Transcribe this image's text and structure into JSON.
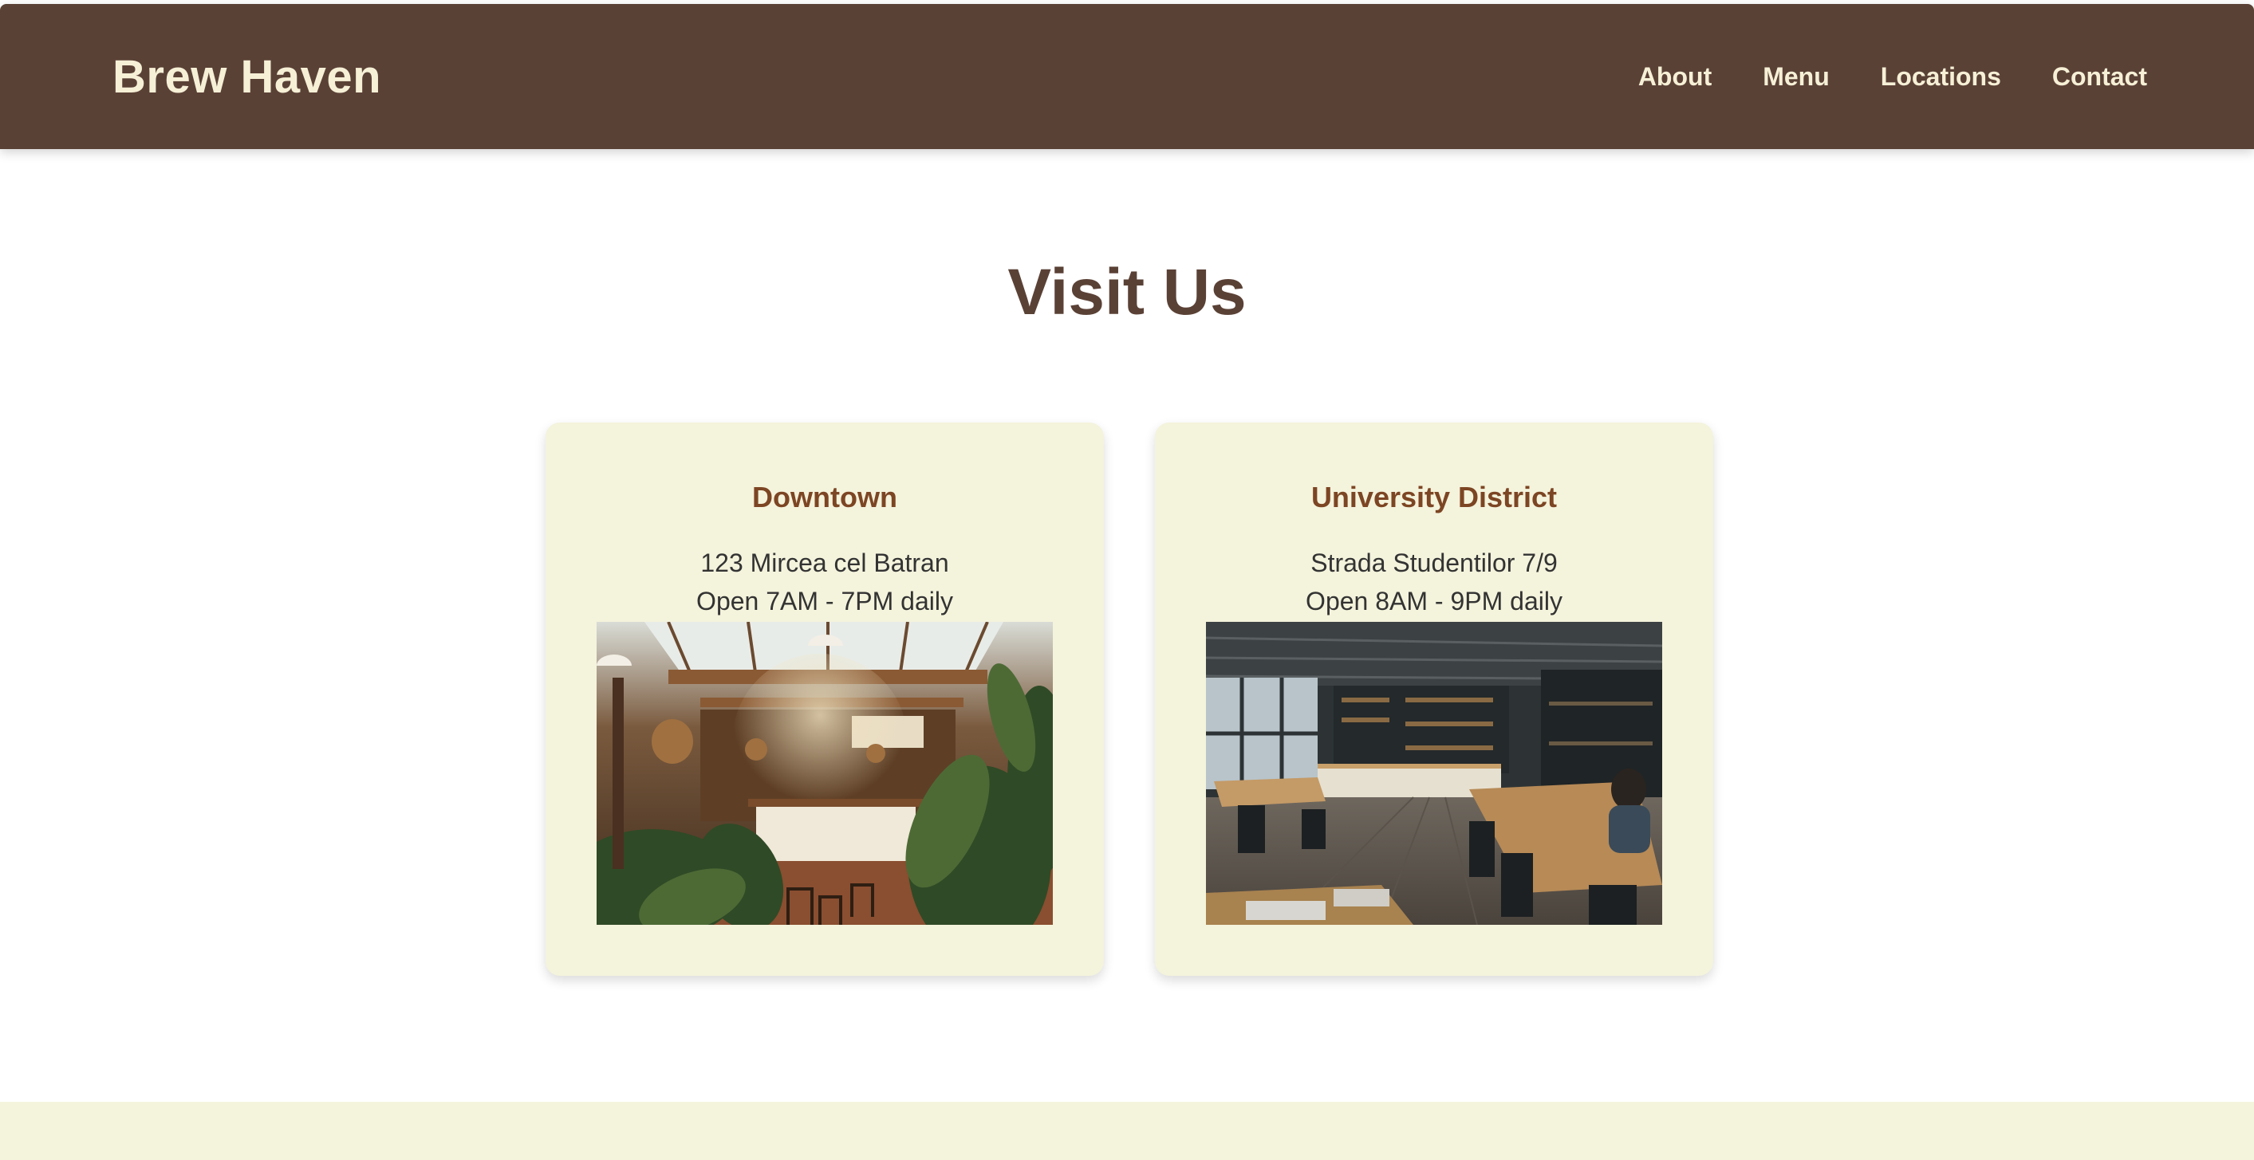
{
  "header": {
    "brand": "Brew Haven",
    "nav": [
      "About",
      "Menu",
      "Locations",
      "Contact"
    ]
  },
  "main": {
    "title": "Visit Us",
    "locations": [
      {
        "name": "Downtown",
        "address": "123 Mircea cel Batran",
        "hours": "Open 7AM - 7PM daily"
      },
      {
        "name": "University District",
        "address": "Strada Studentilor 7/9",
        "hours": "Open 8AM - 9PM daily"
      }
    ]
  },
  "colors": {
    "header_bg": "#5a4136",
    "header_text": "#f6f0d6",
    "card_bg": "#f4f3dc",
    "card_title": "#7c4523",
    "footer_bg": "#f4f3dc"
  }
}
